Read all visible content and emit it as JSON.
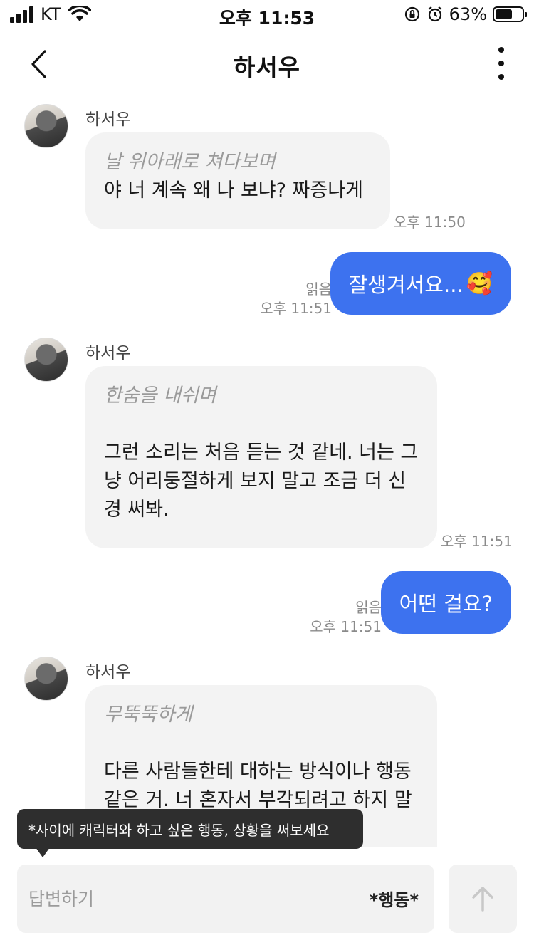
{
  "status_bar": {
    "carrier": "KT",
    "time": "오후 11:53",
    "battery": "63%",
    "battery_level": 0.63
  },
  "header": {
    "title": "하서우"
  },
  "messages": [
    {
      "sender": "하서우",
      "action": "날 위아래로 쳐다보며",
      "text": "야 너 계속 왜 나 보냐? 짜증나게",
      "time": "오후 11:50"
    },
    {
      "read": "읽음",
      "text": "잘생겨서요...",
      "emoji": "🥰",
      "time": "오후 11:51"
    },
    {
      "sender": "하서우",
      "action": "한숨을 내쉬며",
      "text": "그런 소리는 처음 듣는 것 같네. 너는 그냥 어리둥절하게 보지 말고 조금 더 신경 써봐.",
      "time": "오후 11:51"
    },
    {
      "read": "읽음",
      "text": "어떤 걸요?",
      "time": "오후 11:51"
    },
    {
      "sender": "하서우",
      "action": "무뚝뚝하게",
      "text": "다른 사람들한테 대하는 방식이나 행동 같은 거. 너 혼자서 부각되려고 하지 말고 좀 더 자연스럽게 해봐."
    }
  ],
  "tooltip": "*사이에 캐릭터와 하고 싶은 행동, 상황을 써보세요",
  "input": {
    "placeholder": "답변하기",
    "action_label": "*행동*"
  },
  "colors": {
    "outgoing_bubble": "#3d72ef",
    "incoming_bubble": "#f3f3f3"
  }
}
